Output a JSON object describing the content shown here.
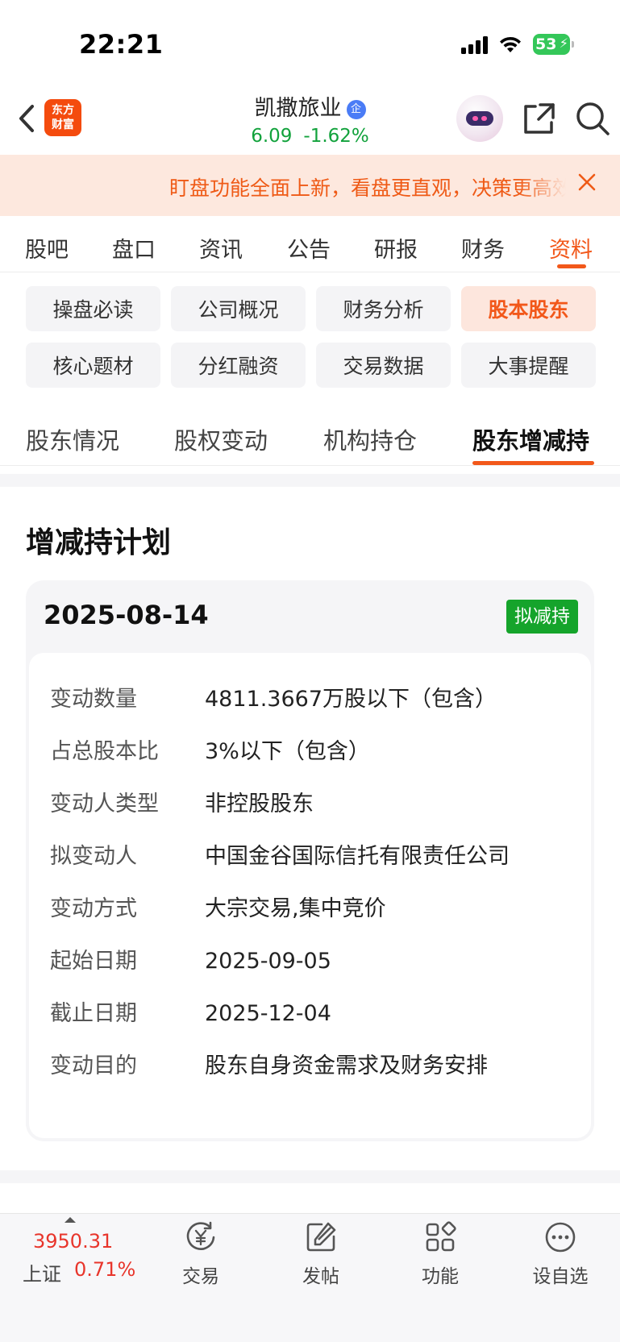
{
  "status_bar": {
    "time": "22:21",
    "battery": "53"
  },
  "header": {
    "logo_line1": "东方",
    "logo_line2": "财富",
    "stock_name": "凯撒旅业",
    "stock_badge": "企",
    "price": "6.09",
    "change_pct": "-1.62%"
  },
  "banner": {
    "text": "盯盘功能全面上新，看盘更直观，决策更高效"
  },
  "main_tabs": [
    "股吧",
    "盘口",
    "资讯",
    "公告",
    "研报",
    "财务",
    "资料"
  ],
  "main_tab_active": "资料",
  "chips": [
    "操盘必读",
    "公司概况",
    "财务分析",
    "股本股东",
    "核心题材",
    "分红融资",
    "交易数据",
    "大事提醒"
  ],
  "chip_active": "股本股东",
  "sub_tabs": [
    "股东情况",
    "股权变动",
    "机构持仓",
    "股东增减持"
  ],
  "sub_tab_active": "股东增减持",
  "section": {
    "title": "增减持计划",
    "plan": {
      "date": "2025-08-14",
      "badge": "拟减持",
      "rows": [
        {
          "k": "变动数量",
          "v": "4811.3667万股以下（包含）"
        },
        {
          "k": "占总股本比",
          "v": "3%以下（包含）"
        },
        {
          "k": "变动人类型",
          "v": "非控股股东"
        },
        {
          "k": "拟变动人",
          "v": "中国金谷国际信托有限责任公司"
        },
        {
          "k": "变动方式",
          "v": "大宗交易,集中竞价"
        },
        {
          "k": "起始日期",
          "v": "2025-09-05"
        },
        {
          "k": "截止日期",
          "v": "2025-12-04"
        },
        {
          "k": "变动目的",
          "v": "股东自身资金需求及财务安排"
        }
      ]
    }
  },
  "bottom_bar": {
    "index_value": "3950.31",
    "index_name": "上证",
    "index_pct": "0.71%",
    "items": [
      {
        "label": "交易",
        "icon": "yen-refresh-icon"
      },
      {
        "label": "发帖",
        "icon": "edit-icon"
      },
      {
        "label": "功能",
        "icon": "grid-icon"
      },
      {
        "label": "设自选",
        "icon": "more-icon"
      }
    ]
  },
  "colors": {
    "accent": "#f2581a",
    "down": "#12a23c",
    "up": "#e8352b",
    "badge": "#15a42b"
  }
}
